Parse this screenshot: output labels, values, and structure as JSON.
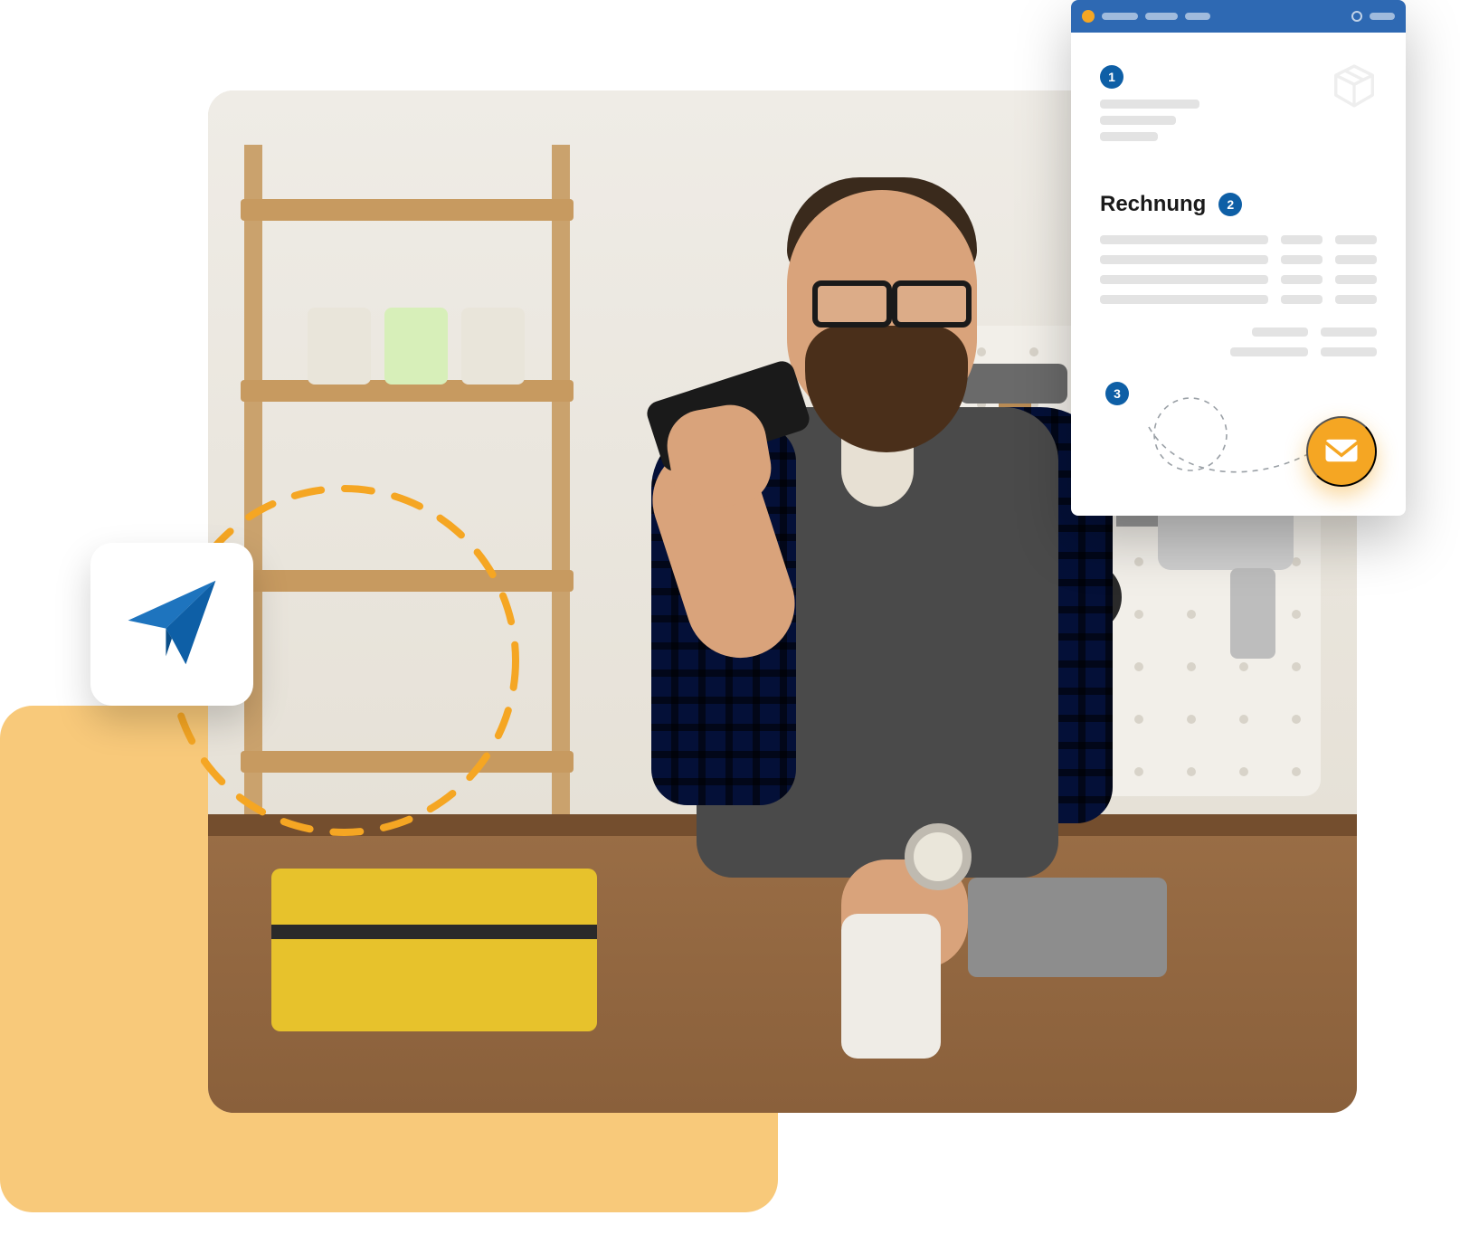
{
  "invoice": {
    "title": "Rechnung",
    "steps": {
      "one": "1",
      "two": "2",
      "three": "3"
    }
  },
  "icons": {
    "plane": "paper-plane-icon",
    "mail": "mail-icon",
    "box": "package-icon"
  },
  "colors": {
    "accent_blue": "#0E5FA6",
    "topbar_blue": "#2E69B3",
    "orange": "#F5A623",
    "soft_orange": "#F8C97A"
  }
}
